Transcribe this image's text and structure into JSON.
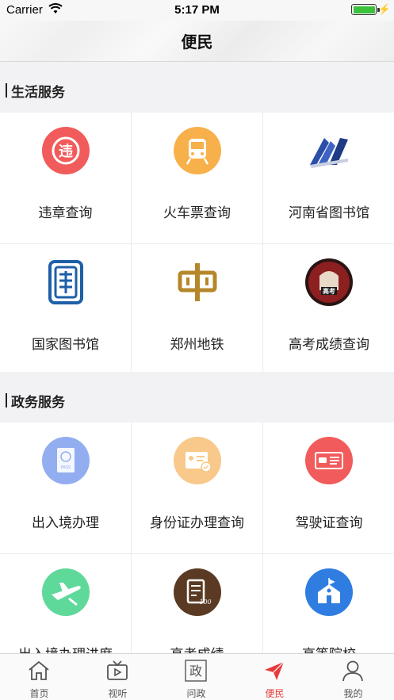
{
  "status_bar": {
    "carrier": "Carrier",
    "time": "5:17 PM",
    "battery_level": 1.0
  },
  "nav": {
    "title": "便民"
  },
  "sections": [
    {
      "title": "生活服务",
      "items": [
        {
          "label": "违章查询",
          "icon": "violation-icon",
          "color": "#f25b5b"
        },
        {
          "label": "火车票查询",
          "icon": "train-icon",
          "color": "#f7b04a"
        },
        {
          "label": "河南省图书馆",
          "icon": "henan-library-logo-icon",
          "color": "#2b4fa8"
        },
        {
          "label": "国家图书馆",
          "icon": "national-library-logo-icon",
          "color": "#1e5fa8"
        },
        {
          "label": "郑州地铁",
          "icon": "zhengzhou-metro-logo-icon",
          "color": "#b5872a"
        },
        {
          "label": "高考成绩查询",
          "icon": "gaokao-fist-icon",
          "color": "#3a1f1f"
        }
      ]
    },
    {
      "title": "政务服务",
      "items": [
        {
          "label": "出入境办理",
          "icon": "passport-icon",
          "color": "#93aef0"
        },
        {
          "label": "身份证办理查询",
          "icon": "id-card-icon",
          "color": "#f8c98a"
        },
        {
          "label": "驾驶证查询",
          "icon": "driver-license-icon",
          "color": "#f25b5b"
        },
        {
          "label": "出入境办理进度",
          "icon": "flight-icon",
          "color": "#5fd99a"
        },
        {
          "label": "高考成绩",
          "icon": "score-sheet-icon",
          "color": "#5a3a22"
        },
        {
          "label": "高等院校",
          "icon": "university-icon",
          "color": "#2f7de1"
        }
      ]
    }
  ],
  "tabs": [
    {
      "label": "首页",
      "icon": "home-icon",
      "active": false
    },
    {
      "label": "视听",
      "icon": "tv-icon",
      "active": false
    },
    {
      "label": "问政",
      "icon": "politics-icon",
      "active": false
    },
    {
      "label": "便民",
      "icon": "paper-plane-icon",
      "active": true
    },
    {
      "label": "我的",
      "icon": "user-icon",
      "active": false
    }
  ],
  "colors": {
    "accent": "#e63b3b",
    "section_bg": "#f2f2f5"
  }
}
